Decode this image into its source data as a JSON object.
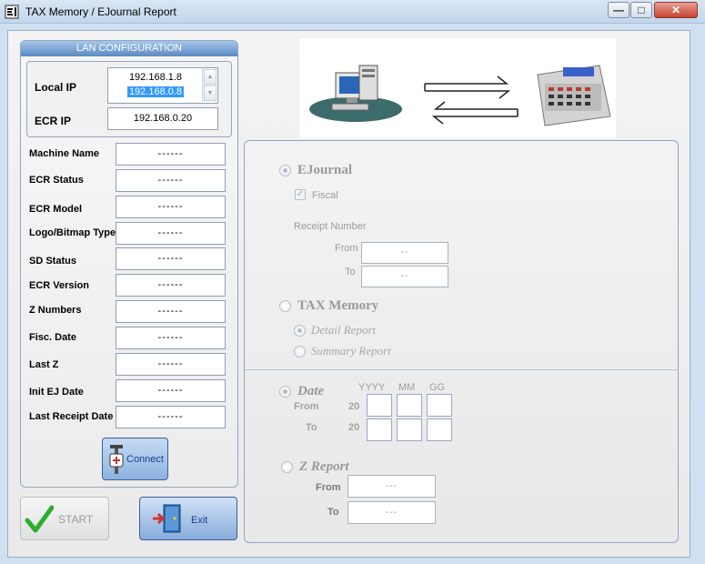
{
  "window": {
    "title": "TAX Memory / EJournal Report",
    "min_label": "—",
    "max_label": "□",
    "close_label": "✕"
  },
  "lan": {
    "header": "LAN CONFIGURATION",
    "local_ip_label": "Local IP",
    "local_ip_options": [
      "192.168.1.8",
      "192.168.0.8"
    ],
    "local_ip_selected": "192.168.0.8",
    "ecr_ip_label": "ECR IP",
    "ecr_ip_value": "192.168.0.20"
  },
  "info_fields": [
    {
      "label": "Machine Name",
      "value": "------"
    },
    {
      "label": "ECR Status",
      "value": "------"
    },
    {
      "label": "ECR Model",
      "value": "------"
    },
    {
      "label": "Logo/Bitmap Type",
      "value": "------"
    },
    {
      "label": "SD Status",
      "value": "------"
    },
    {
      "label": "ECR Version",
      "value": "------"
    },
    {
      "label": "Z Numbers",
      "value": "------"
    },
    {
      "label": "Fisc. Date",
      "value": "------"
    },
    {
      "label": "Last Z",
      "value": "------"
    },
    {
      "label": "Init EJ Date",
      "value": "------"
    },
    {
      "label": "Last Receipt Date",
      "value": "------"
    }
  ],
  "buttons": {
    "connect": "Connect",
    "start": "START",
    "exit": "Exit"
  },
  "report": {
    "ejournal_label": "EJournal",
    "fiscal_label": "Fiscal",
    "receipt_number_label": "Receipt Number",
    "from_label": "From",
    "to_label": "To",
    "receipt_from_value": "--",
    "receipt_to_value": "--",
    "tax_memory_label": "TAX Memory",
    "detail_report_label": "Detail Report",
    "summary_report_label": "Summary Report",
    "date_label": "Date",
    "yyyy_label": "YYYY",
    "mm_label": "MM",
    "gg_label": "GG",
    "century_prefix": "20",
    "z_report_label": "Z Report",
    "z_from_value": "---",
    "z_to_value": "---"
  },
  "colors": {
    "title_bar": "#c2d6ec",
    "group_header": "#5b8ac4",
    "selection": "#3399ff",
    "disabled_text": "#9c9c9c"
  }
}
